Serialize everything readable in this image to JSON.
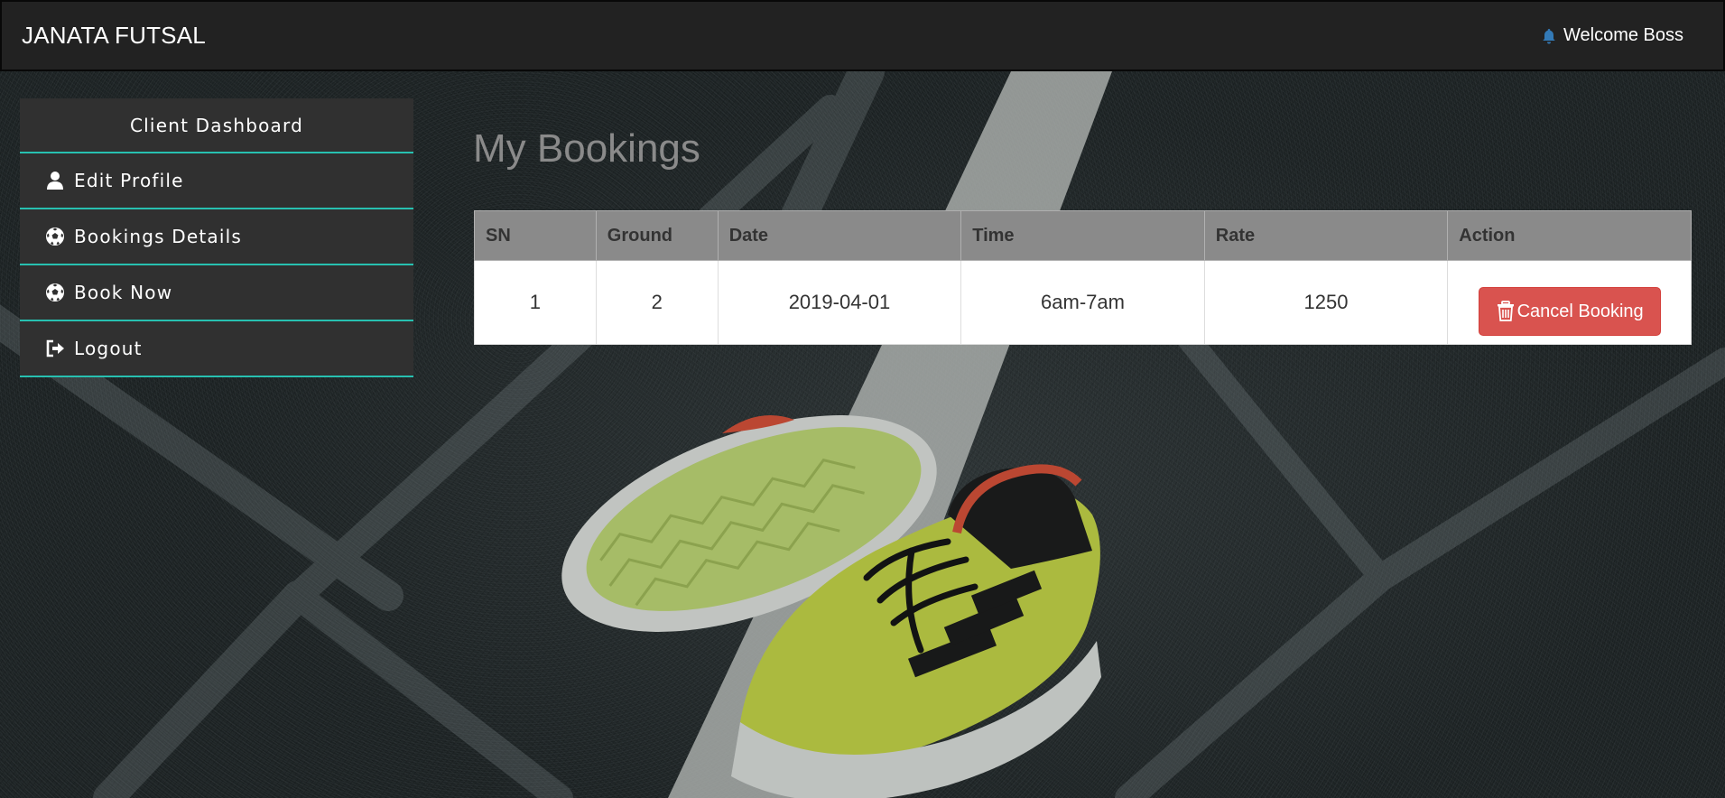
{
  "navbar": {
    "brand": "JANATA FUTSAL",
    "welcome": "Welcome Boss",
    "icon": "bell-icon",
    "icon_color": "#337ab7"
  },
  "sidebar": {
    "heading": "Client Dashboard",
    "items": [
      {
        "label": "Edit Profile",
        "icon": "user-icon"
      },
      {
        "label": "Bookings Details",
        "icon": "soccer-ball-icon"
      },
      {
        "label": "Book Now",
        "icon": "soccer-ball-icon"
      },
      {
        "label": "Logout",
        "icon": "logout-icon"
      }
    ],
    "accent_color": "#27c0b0"
  },
  "main": {
    "title": "My Bookings",
    "table": {
      "headers": [
        "SN",
        "Ground",
        "Date",
        "Time",
        "Rate",
        "Action"
      ],
      "rows": [
        {
          "sn": "1",
          "ground": "2",
          "date": "2019-04-01",
          "time": "6am-7am",
          "rate": "1250",
          "action": "Cancel Booking"
        }
      ]
    },
    "cancel_color": "#d9534f"
  }
}
